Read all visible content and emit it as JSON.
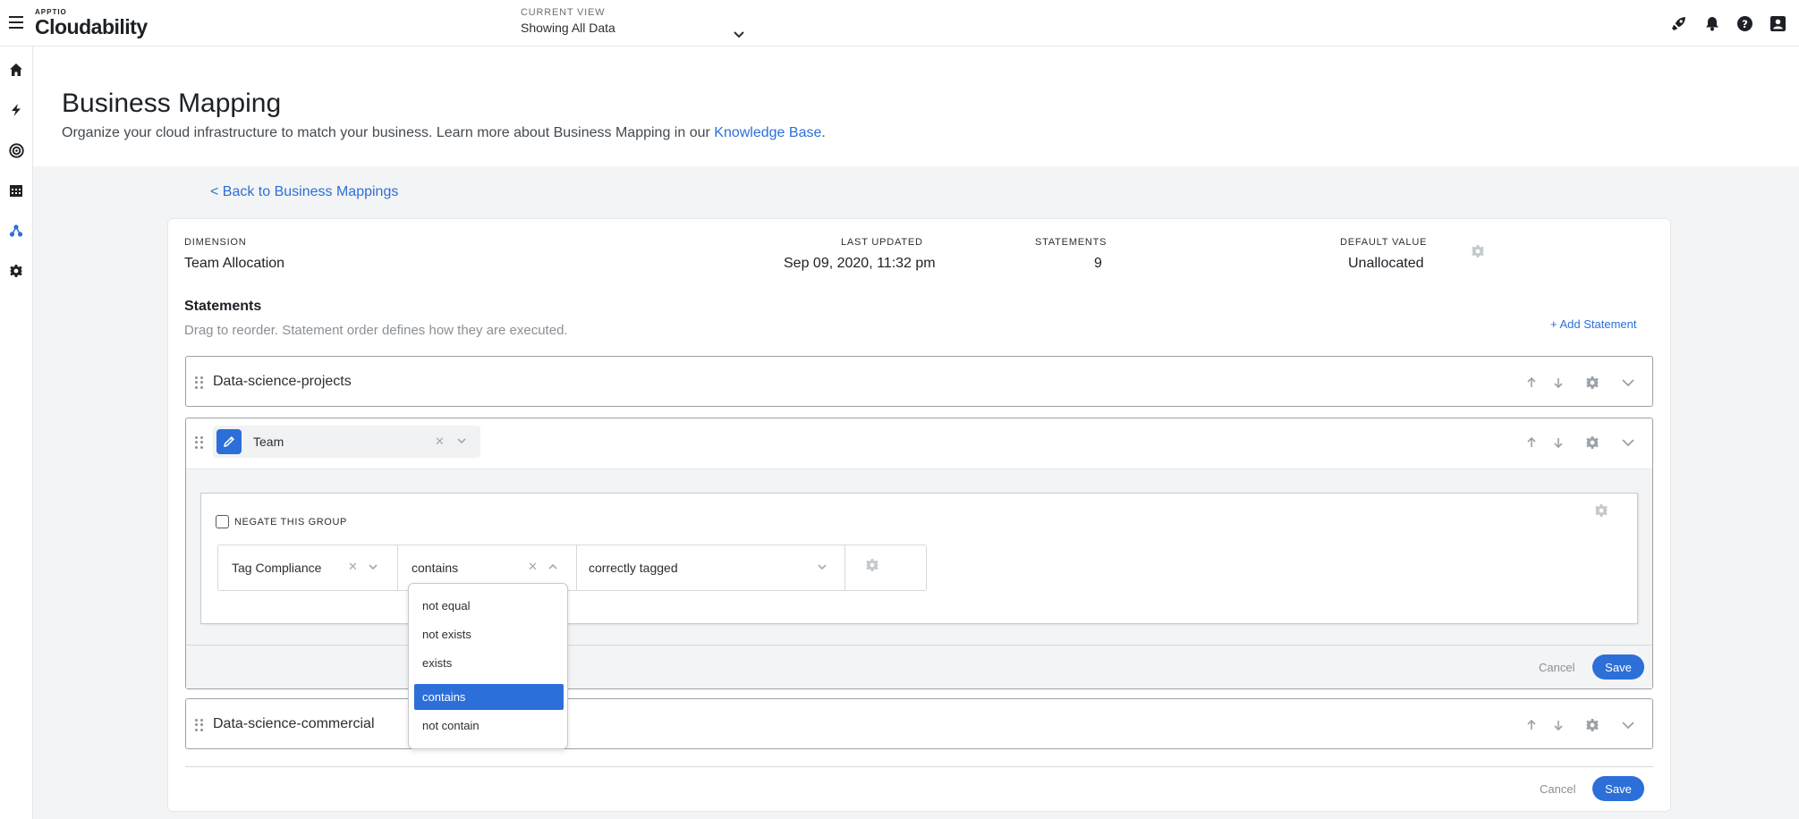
{
  "topbar": {
    "brand_small": "APPTIO",
    "brand_name": "Cloudability",
    "current_view_label": "CURRENT VIEW",
    "current_view_value": "Showing All Data",
    "icons": [
      "rocket-icon",
      "bell-icon",
      "help-icon",
      "user-icon"
    ]
  },
  "sidebar": {
    "icons": [
      "home-icon",
      "lightning-icon",
      "target-icon",
      "calendar-icon",
      "business-mapping-icon",
      "settings-icon"
    ]
  },
  "page": {
    "title": "Business Mapping",
    "subtitle": "Organize your cloud infrastructure to match your business. Learn more about Business Mapping in our",
    "kb_link": "Knowledge Base",
    "period": ".",
    "back_link": "< Back to Business Mappings"
  },
  "meta": {
    "dimension_label": "DIMENSION",
    "dimension_value": "Team Allocation",
    "updated_label": "LAST UPDATED",
    "updated_value": "Sep 09, 2020, 11:32 pm",
    "statements_label": "STATEMENTS",
    "statements_value": "9",
    "default_label": "DEFAULT VALUE",
    "default_value": "Unallocated"
  },
  "statements": {
    "title": "Statements",
    "subtitle": "Drag to reorder. Statement order defines how they are executed.",
    "add_label": "+ Add Statement",
    "items": [
      {
        "name": "Data-science-projects"
      },
      {
        "name": "Team"
      },
      {
        "name": "Data-science-commercial"
      }
    ]
  },
  "editor": {
    "negate_label": "NEGATE THIS GROUP",
    "condition": {
      "field": "Tag Compliance",
      "operator": "contains",
      "value": "correctly tagged"
    },
    "cancel_label": "Cancel",
    "save_label": "Save"
  },
  "operator_dropdown": {
    "options": [
      "not equal",
      "not exists",
      "exists",
      "contains",
      "not contain"
    ],
    "selected": "contains"
  },
  "footer": {
    "cancel_label": "Cancel",
    "save_label": "Save"
  },
  "colors": {
    "accent": "#2c6fd9",
    "background": "#f3f4f5"
  }
}
